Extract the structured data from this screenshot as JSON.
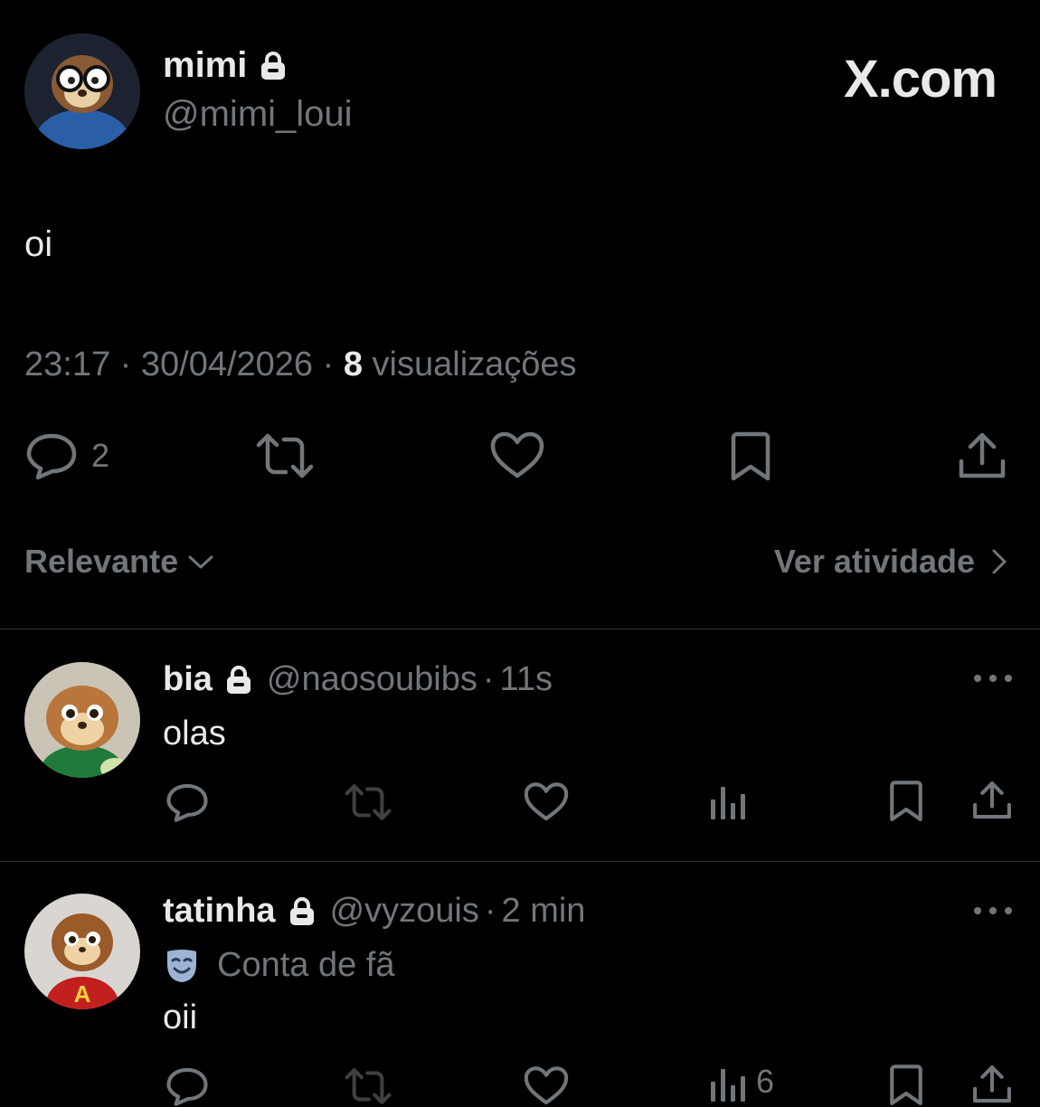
{
  "brand": {
    "label": "X.com"
  },
  "tweet": {
    "name": "mimi",
    "handle": "@mimi_loui",
    "text": "oi",
    "time": "23:17",
    "date": "30/04/2026",
    "views_count": "8",
    "views_label": "visualizações",
    "reply_count": "2"
  },
  "sort": {
    "label": "Relevante"
  },
  "activity": {
    "label": "Ver atividade"
  },
  "replies": [
    {
      "name": "bia",
      "handle": "@naosoubibs",
      "time": "11s",
      "text": "olas"
    },
    {
      "name": "tatinha",
      "handle": "@vyzouis",
      "time": "2 min",
      "badge_label": "Conta de fã",
      "text": "oii",
      "views_count": "6"
    }
  ],
  "colors": {
    "background": "#000000",
    "text": "#e7e9ea",
    "muted": "#71767b",
    "divider": "#2f3336"
  }
}
